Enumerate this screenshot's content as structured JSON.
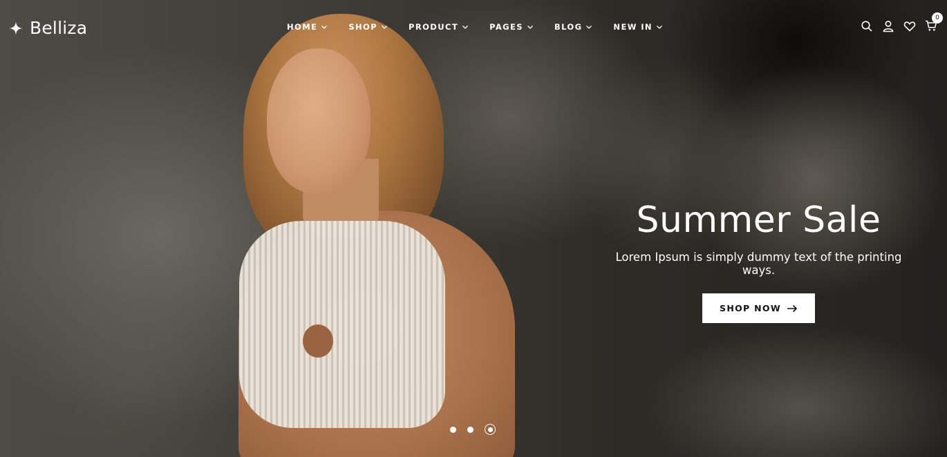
{
  "brand": {
    "name": "Belliza",
    "logo_icon": "sparkle-star-icon"
  },
  "nav": {
    "items": [
      {
        "label": "HOME"
      },
      {
        "label": "SHOP"
      },
      {
        "label": "PRODUCT"
      },
      {
        "label": "PAGES"
      },
      {
        "label": "BLOG"
      },
      {
        "label": "NEW IN"
      }
    ],
    "dropdown_icon": "chevron-down-icon"
  },
  "header_icons": {
    "search": "search-icon",
    "account": "user-icon",
    "wishlist": "heart-icon",
    "cart": "cart-icon",
    "cart_count": "0"
  },
  "slider": {
    "title": "Summer Sale",
    "subtitle": "Lorem Ipsum is simply dummy text of the printing ways.",
    "button_label": "SHOP NOW",
    "button_icon": "arrow-right-icon",
    "slides_count": 3,
    "active_slide": 3
  },
  "colors": {
    "text": "#ffffff",
    "button_bg": "#ffffff",
    "button_text": "#111111"
  }
}
